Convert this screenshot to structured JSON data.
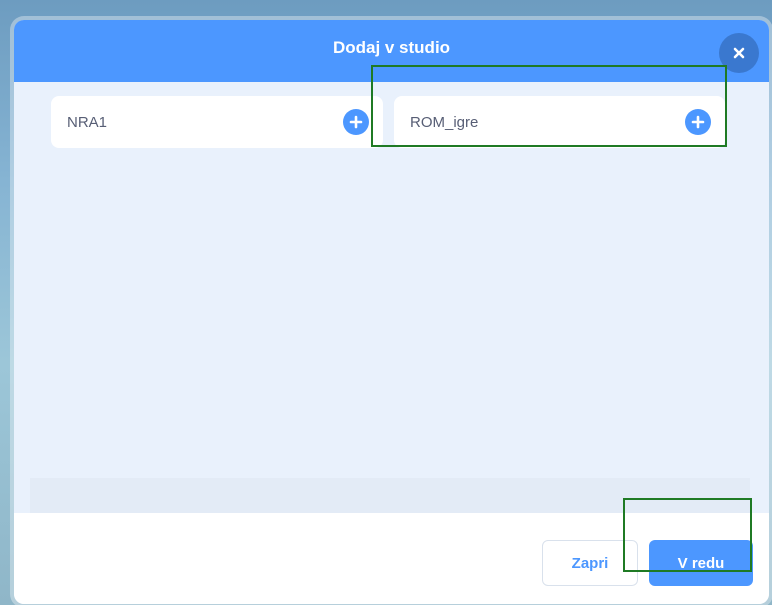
{
  "dialog": {
    "title": "Dodaj v studio",
    "close_icon": "close-icon"
  },
  "studios": [
    {
      "name": "NRA1",
      "action_icon": "plus-circle-icon"
    },
    {
      "name": "ROM_igre",
      "action_icon": "plus-circle-icon"
    }
  ],
  "footer": {
    "cancel_label": "Zapri",
    "ok_label": "V redu"
  },
  "colors": {
    "accent": "#4c97ff",
    "header_bg": "#4c97ff",
    "close_bg": "#3a78cf",
    "body_bg": "#e9f1fc",
    "text": "#575e75",
    "highlight": "#1f7a24"
  }
}
